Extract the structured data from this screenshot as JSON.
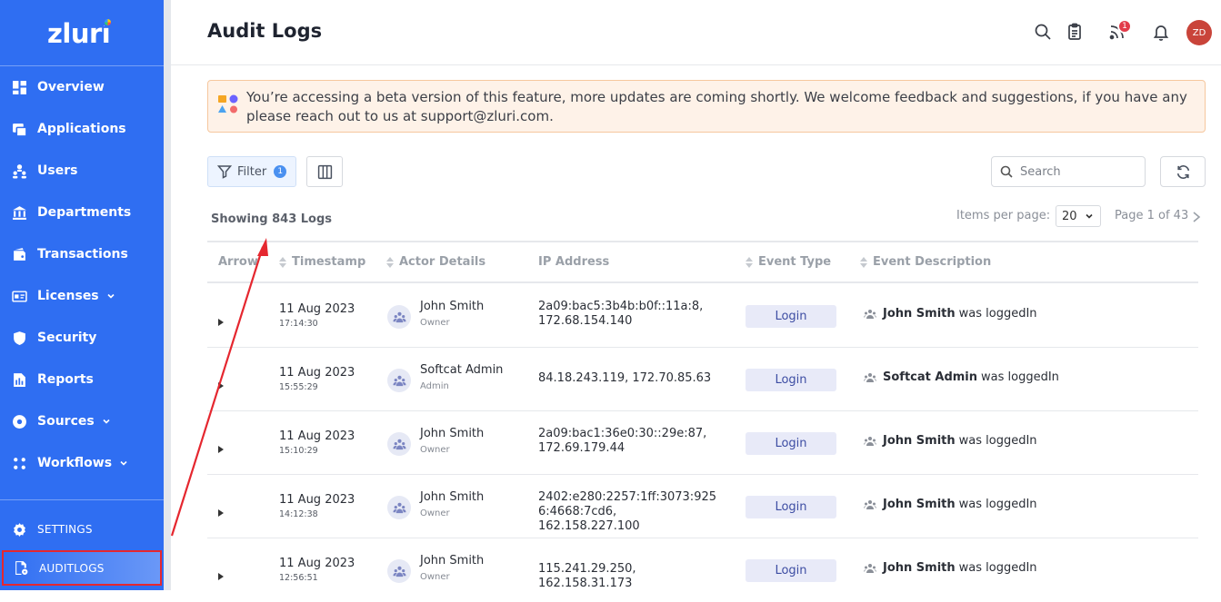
{
  "sidebar": {
    "logo": "zluri",
    "items": [
      {
        "label": "Overview",
        "icon": "grid-icon",
        "chevron": false
      },
      {
        "label": "Applications",
        "icon": "apps-icon",
        "chevron": false
      },
      {
        "label": "Users",
        "icon": "users-icon",
        "chevron": false
      },
      {
        "label": "Departments",
        "icon": "building-icon",
        "chevron": false
      },
      {
        "label": "Transactions",
        "icon": "wallet-icon",
        "chevron": false
      },
      {
        "label": "Licenses",
        "icon": "license-icon",
        "chevron": true
      },
      {
        "label": "Security",
        "icon": "shield-icon",
        "chevron": false
      },
      {
        "label": "Reports",
        "icon": "report-icon",
        "chevron": false
      },
      {
        "label": "Sources",
        "icon": "sources-icon",
        "chevron": true
      },
      {
        "label": "Workflows",
        "icon": "workflow-icon",
        "chevron": true
      }
    ],
    "settings_label": "SETTINGS",
    "auditlogs_label": "AUDITLOGS"
  },
  "header": {
    "title": "Audit Logs",
    "notification_count": "1",
    "avatar_initials": "ZD"
  },
  "banner": {
    "text": "You’re accessing a beta version of this feature, more updates are coming shortly. We welcome feedback and suggestions, if you have any please reach out to us at support@zluri.com."
  },
  "toolbar": {
    "filter_label": "Filter",
    "filter_count": "1",
    "search_placeholder": "Search"
  },
  "summary": {
    "showing": "Showing 843 Logs",
    "items_per_page_label": "Items per page:",
    "items_per_page": "20",
    "page_label": "Page 1 of 43"
  },
  "table": {
    "columns": [
      "Arrow",
      "Timestamp",
      "Actor Details",
      "IP Address",
      "Event Type",
      "Event Description"
    ],
    "rows": [
      {
        "date": "11 Aug 2023",
        "time": "17:14:30",
        "actor": "John Smith",
        "role": "Owner",
        "ip_line1": "2a09:bac5:3b4b:b0f::11a:8,",
        "ip_line2": "172.68.154.140",
        "event": "Login",
        "desc_actor": "John Smith",
        "desc_action": "was loggedIn"
      },
      {
        "date": "11 Aug 2023",
        "time": "15:55:29",
        "actor": "Softcat Admin",
        "role": "Admin",
        "ip_line1": "84.18.243.119, 172.70.85.63",
        "ip_line2": "",
        "event": "Login",
        "desc_actor": "Softcat Admin",
        "desc_action": "was loggedIn"
      },
      {
        "date": "11 Aug 2023",
        "time": "15:10:29",
        "actor": "John Smith",
        "role": "Owner",
        "ip_line1": "2a09:bac1:36e0:30::29e:87,",
        "ip_line2": "172.69.179.44",
        "event": "Login",
        "desc_actor": "John Smith",
        "desc_action": "was loggedIn"
      },
      {
        "date": "11 Aug 2023",
        "time": "14:12:38",
        "actor": "John Smith",
        "role": "Owner",
        "ip_line1": "2402:e280:2257:1ff:3073:925",
        "ip_line2": "6:4668:7cd6, 162.158.227.100",
        "event": "Login",
        "desc_actor": "John Smith",
        "desc_action": "was loggedIn"
      },
      {
        "date": "11 Aug 2023",
        "time": "12:56:51",
        "actor": "John Smith",
        "role": "Owner",
        "ip_line1": "115.241.29.250, 162.158.31.173",
        "ip_line2": "",
        "event": "Login",
        "desc_actor": "John Smith",
        "desc_action": "was loggedIn"
      }
    ]
  },
  "colors": {
    "sidebar": "#2f6ef2",
    "annotation": "#e5272f",
    "event_badge_bg": "#e8eaf8"
  }
}
